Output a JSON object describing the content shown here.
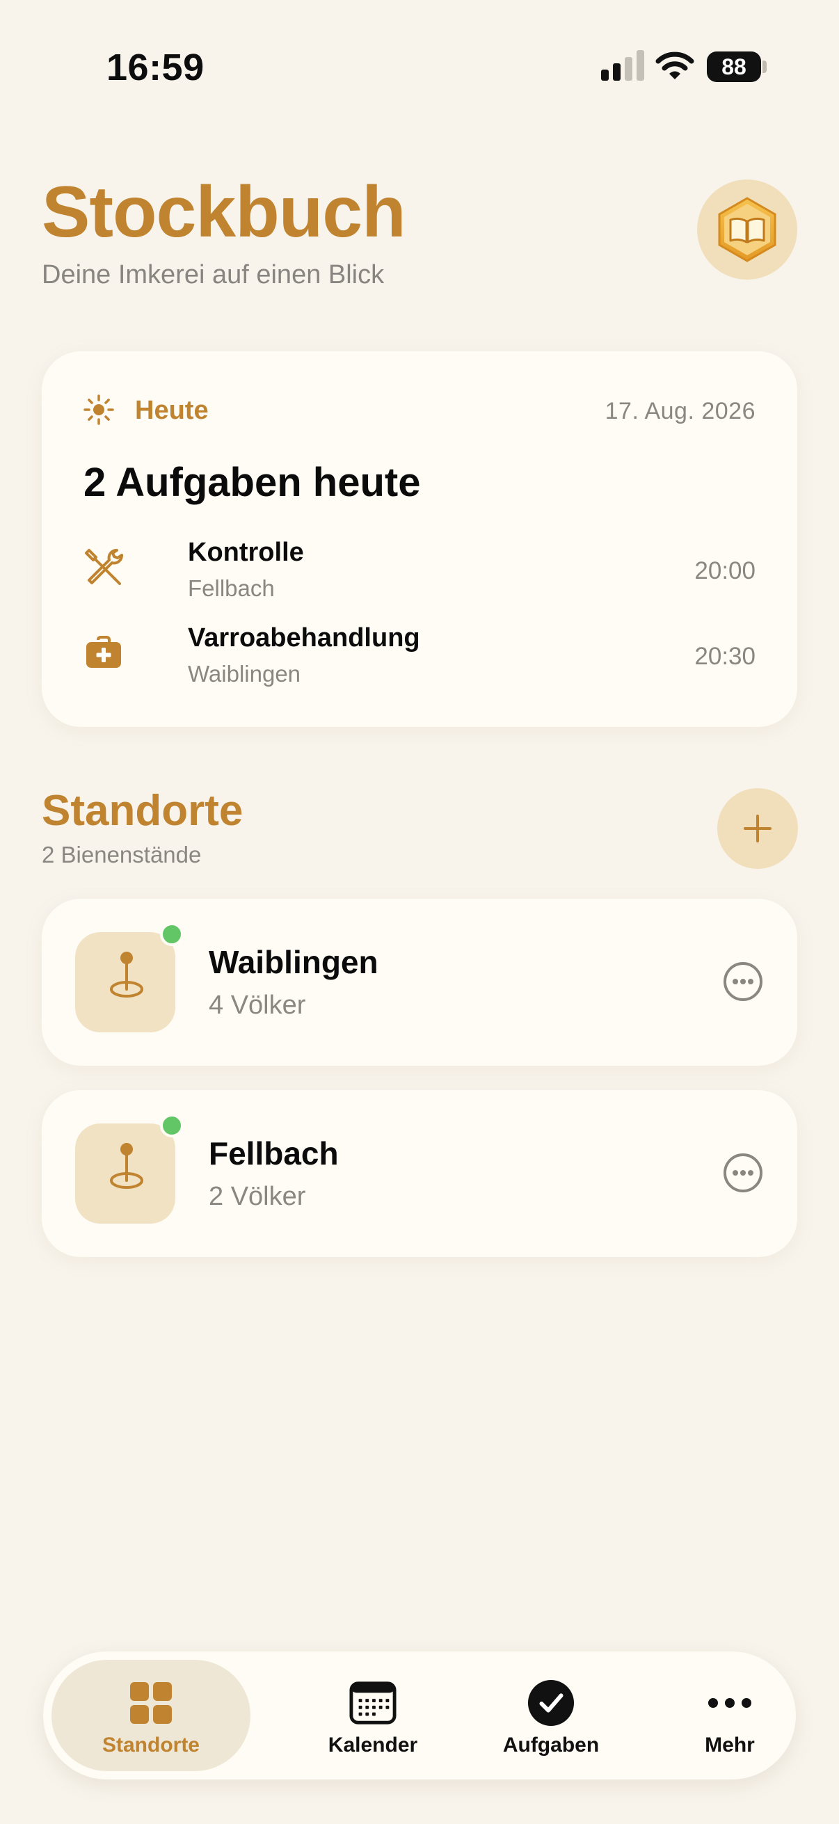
{
  "status_bar": {
    "time": "16:59",
    "battery": "88"
  },
  "header": {
    "title": "Stockbuch",
    "subtitle": "Deine Imkerei auf einen Blick",
    "logo_icon": "book-hexagon-icon"
  },
  "today": {
    "label": "Heute",
    "date": "17. Aug. 2026",
    "headline": "2 Aufgaben heute",
    "tasks": [
      {
        "title": "Kontrolle",
        "location": "Fellbach",
        "time": "20:00",
        "icon": "tools-icon"
      },
      {
        "title": "Varroabehandlung",
        "location": "Waiblingen",
        "time": "20:30",
        "icon": "medkit-icon"
      }
    ]
  },
  "locations_section": {
    "title": "Standorte",
    "subtitle": "2 Bienenstände"
  },
  "locations": [
    {
      "name": "Waiblingen",
      "count": "4 Völker",
      "status_color": "#62c667"
    },
    {
      "name": "Fellbach",
      "count": "2 Völker",
      "status_color": "#62c667"
    }
  ],
  "tabs": [
    {
      "label": "Standorte",
      "icon": "grid-icon",
      "active": true
    },
    {
      "label": "Kalender",
      "icon": "calendar-icon",
      "active": false
    },
    {
      "label": "Aufgaben",
      "icon": "checkmark-circle-icon",
      "active": false
    },
    {
      "label": "Mehr",
      "icon": "ellipsis-icon",
      "active": false
    }
  ],
  "colors": {
    "accent": "#c0832f",
    "background": "#f8f4ec",
    "card": "#fefcf4",
    "accent_soft": "#f1dfbb"
  }
}
